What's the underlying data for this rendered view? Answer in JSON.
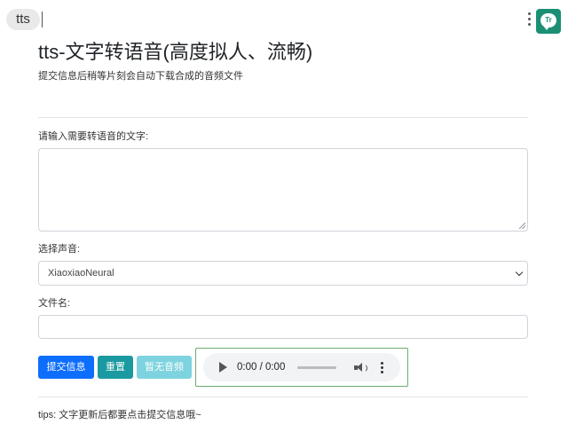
{
  "browser": {
    "tab_label": "tts",
    "extension_icon_text": "Tr"
  },
  "header": {
    "title": "tts-文字转语音(高度拟人、流畅)",
    "subtitle": "提交信息后稍等片刻会自动下载合成的音频文件"
  },
  "form": {
    "text_label": "请输入需要转语音的文字:",
    "text_value": "",
    "voice_label": "选择声音:",
    "voice_selected": "XiaoxiaoNeural",
    "filename_label": "文件名:",
    "filename_value": ""
  },
  "buttons": {
    "submit": "提交信息",
    "reset": "重置",
    "no_audio": "暂无音频"
  },
  "audio_player": {
    "time": "0:00 / 0:00",
    "progress": 0
  },
  "footer": {
    "tips": "tips: 文字更新后都要点击提交信息哦~"
  }
}
